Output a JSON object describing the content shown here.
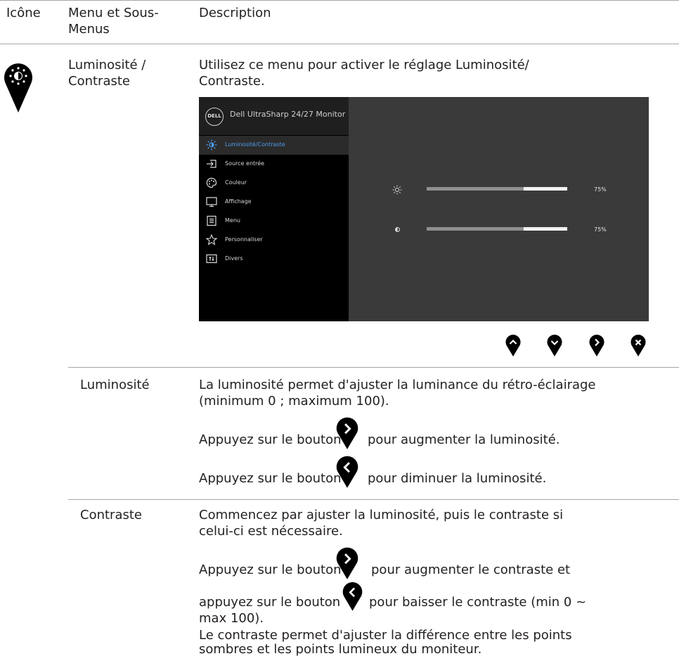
{
  "header": {
    "col_icon": "Icône",
    "col_menu_line1": "Menu et Sous-",
    "col_menu_line2": "Menus",
    "col_desc": "Description"
  },
  "main_row": {
    "menu_line1": "Luminosité /",
    "menu_line2": "Contraste",
    "desc_line1": "Utilisez ce menu pour activer le réglage Luminosité/",
    "desc_line2": "Contraste.",
    "icon": "brightness-pin-icon"
  },
  "osd": {
    "logo": "DELL",
    "title": "Dell UltraSharp 24/27 Monitor",
    "items": [
      {
        "label": "Luminosité/Contraste",
        "icon": "brightness-icon",
        "selected": true
      },
      {
        "label": "Source entrée",
        "icon": "input-source-icon"
      },
      {
        "label": "Couleur",
        "icon": "palette-icon"
      },
      {
        "label": "Affichage",
        "icon": "monitor-icon"
      },
      {
        "label": "Menu",
        "icon": "menu-list-icon"
      },
      {
        "label": "Personnaliser",
        "icon": "star-icon"
      },
      {
        "label": "Divers",
        "icon": "sliders-icon"
      }
    ],
    "brightness": {
      "value": 75,
      "label": "75%"
    },
    "contrast": {
      "value": 75,
      "label": "75%"
    },
    "buttons": [
      "up-button-icon",
      "down-button-icon",
      "right-button-icon",
      "close-button-icon"
    ]
  },
  "luminosite": {
    "label": "Luminosité",
    "line1": "La luminosité permet d'ajuster la luminance du rétro-éclairage",
    "line2": "(minimum 0 ; maximum 100).",
    "inc_before": "Appuyez sur le bouton",
    "inc_after": "pour augmenter la luminosité.",
    "dec_before": "Appuyez sur le bouton",
    "dec_after": "pour diminuer la luminosité."
  },
  "contraste": {
    "label": "Contraste",
    "line1": "Commencez par ajuster la luminosité, puis le contraste si",
    "line2": "celui-ci est nécessaire.",
    "inc_before": "Appuyez sur le bouton",
    "inc_after": "pour augmenter le contraste et",
    "dec_before": "appuyez sur le bouton",
    "dec_after": "pour baisser le contraste (min 0 ~",
    "dec_line2": "max 100).",
    "note_line1": "Le contraste permet d'ajuster la différence entre les points",
    "note_line2": "sombres et les points lumineux du moniteur."
  },
  "colors": {
    "accent": "#4d9ef0",
    "pin": "#000000",
    "rule": "#a6a6a6"
  }
}
